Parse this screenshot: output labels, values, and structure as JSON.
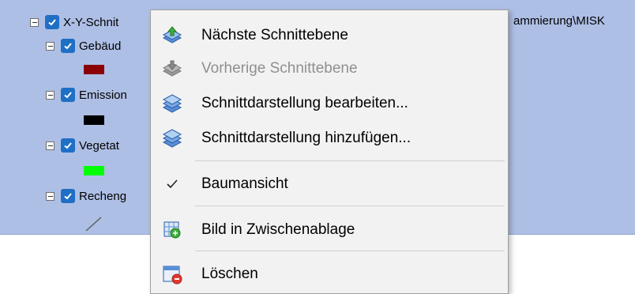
{
  "tree": {
    "root": {
      "label": "X-Y-Schnit",
      "path_tail": "ammierung\\MISK"
    },
    "children": [
      {
        "label": "Gebäud",
        "swatch_color": "#8b0000"
      },
      {
        "label": "Emission",
        "swatch_color": "#000000"
      },
      {
        "label": "Vegetat",
        "swatch_color": "#00ff00"
      },
      {
        "label": "Recheng",
        "swatch_color": null
      }
    ]
  },
  "context_menu": {
    "items": [
      {
        "label": "Nächste Schnittebene",
        "icon": "layers-up-icon",
        "enabled": true
      },
      {
        "label": "Vorherige Schnittebene",
        "icon": "layers-down-icon",
        "enabled": false
      },
      {
        "label": "Schnittdarstellung bearbeiten...",
        "icon": "layers-edit-icon",
        "enabled": true
      },
      {
        "label": "Schnittdarstellung hinzufügen...",
        "icon": "layers-add-icon",
        "enabled": true
      },
      {
        "label": "Baumansicht",
        "icon": "checkmark-icon",
        "enabled": true,
        "checked": true
      },
      {
        "label": "Bild in Zwischenablage",
        "icon": "clipboard-image-icon",
        "enabled": true
      },
      {
        "label": "Löschen",
        "icon": "delete-window-icon",
        "enabled": true
      }
    ]
  }
}
